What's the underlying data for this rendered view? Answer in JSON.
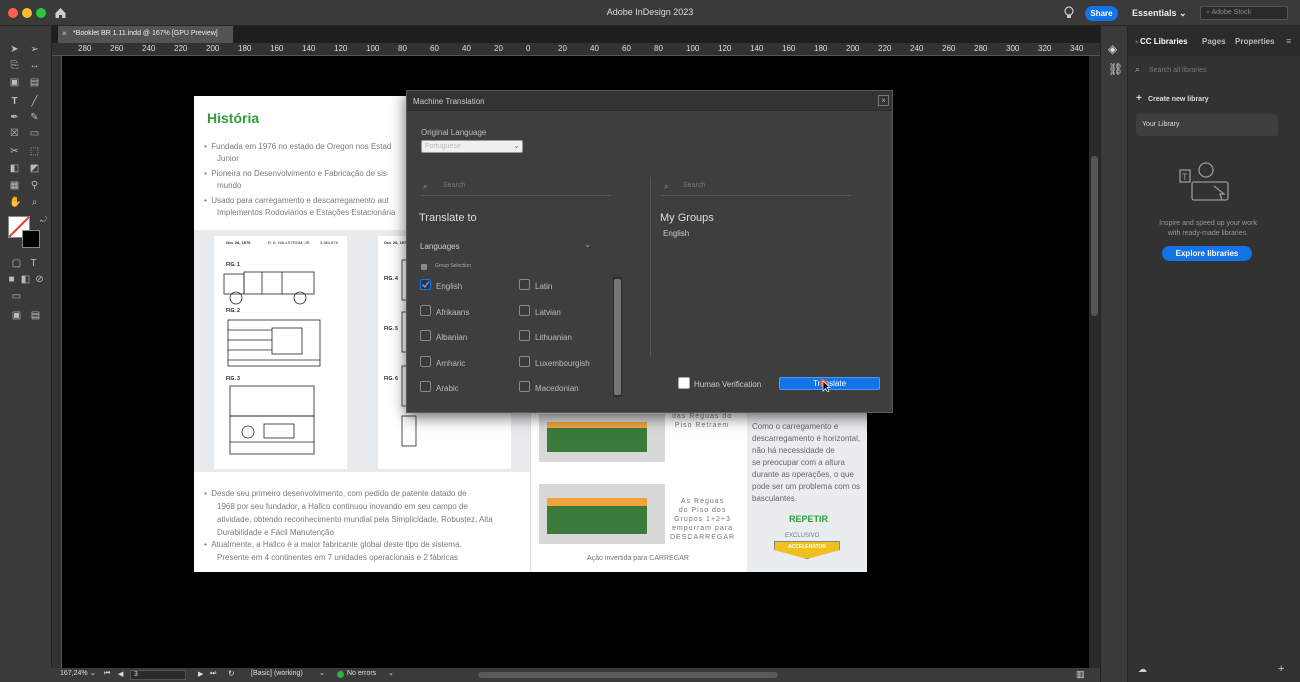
{
  "app_title": "Adobe InDesign 2023",
  "title_bar": {
    "share": "Share",
    "workspace": "Essentials",
    "stock_search": "Adobe Stock"
  },
  "doc_tab": "*Booklet BR 1.11.indd @ 167% [GPU Preview]",
  "ruler_ticks": [
    "280",
    "260",
    "240",
    "220",
    "200",
    "180",
    "160",
    "140",
    "120",
    "100",
    "80",
    "60",
    "40",
    "20",
    "0",
    "20",
    "40",
    "60",
    "80",
    "100",
    "120",
    "140",
    "160",
    "180",
    "200",
    "220",
    "240",
    "260",
    "280",
    "300",
    "320",
    "340"
  ],
  "right_panel": {
    "tabs": [
      "CC Libraries",
      "Pages",
      "Properties"
    ],
    "search_placeholder": "Search all libraries",
    "create_new": "Create new library",
    "your_library": "Your Library",
    "promo": "Inspire and speed up your work with ready-made libraries.",
    "explore": "Explore libraries"
  },
  "status_bar": {
    "zoom": "167,24%",
    "page": "3",
    "style": "[Basic] (working)",
    "errors": "No errors"
  },
  "document": {
    "heading": "História",
    "bullets_top": [
      "Fundada em 1976 no estado de Oregon nos Estad",
      "Junior",
      "Pioneira no Desenvolvimento e Fabricação de sis",
      "mundo",
      "Usado para carregamento e descarregamento aut",
      "Implementos Rodoviários e Estações Estacionária"
    ],
    "patent1_header": [
      "Oct. 26, 1976",
      "R. A. HALLSTROM, JR.",
      "3,984,875"
    ],
    "patent2_header": "Oct. 26, 1976",
    "figs": [
      "FIG. 1",
      "FIG. 2",
      "FIG. 3",
      "FIG. 4",
      "FIG. 5",
      "FIG. 6"
    ],
    "bullets_bottom": [
      "Desde seu primeiro desenvolvimento, com pedido de patente datado de",
      "1968 por seu fundador, a Hallco continuou inovando em seu campo de",
      "atividade, obtendo reconhecimento mundial pela Simplicidade, Robustez, Alta",
      "Durabilidade e Fácil Manutenção",
      "Atualmente, a Hallco é a maior fabricante global deste tipo de sistema.",
      "Presente em 4 continentes em 7 unidades operacionais e 2 fábricas"
    ],
    "mid_text1": [
      "das Réguas do",
      "Piso Retraem"
    ],
    "mid_text2": [
      "As Réguas",
      "do Piso dos",
      "Grupos 1+2+3",
      "empurram para",
      "DESCARREGAR"
    ],
    "mid_caption": "Ação invertida para CARREGAR",
    "right_text": [
      "Como o carregamento e",
      "descarregamento é horizontal,",
      "não há necessidade de",
      "se preocupar com a altura",
      "durante as operações, o que",
      "pode ser um problema com os",
      "basculantes."
    ],
    "repetir": "REPETIR",
    "exclusivo": "EXCLUSIVO",
    "badge": "ACCELERATOR"
  },
  "dialog": {
    "title": "Machine Translation",
    "original_language_label": "Original Language",
    "original_language_value": "Portuguese",
    "search_left": "Search",
    "search_right": "Search",
    "translate_to": "Translate to",
    "my_groups": "My Groups",
    "group_value": "English",
    "languages": "Languages",
    "group_selection": "Group Selection",
    "col1": [
      "English",
      "Afrikaans",
      "Albanian",
      "Amharic",
      "Arabic"
    ],
    "col2": [
      "Latin",
      "Latvian",
      "Lithuanian",
      "Luxembourgish",
      "Macedonian"
    ],
    "human_verification": "Human Verification",
    "translate_btn": "Translate"
  },
  "colors": {
    "accent": "#1473e6",
    "green": "#2e9e3a"
  }
}
